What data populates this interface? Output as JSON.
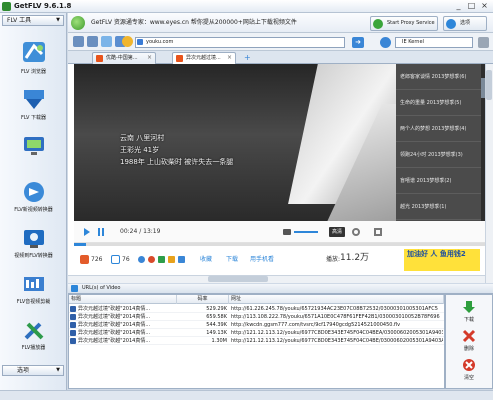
{
  "window": {
    "title": "GetFLV 9.6.1.8",
    "minimize": "_",
    "maximize": "□",
    "close": "×"
  },
  "sidebar": {
    "header": "FLV 工具",
    "items": [
      {
        "label": "FLV 浏览器"
      },
      {
        "label": "FLV 下载器"
      },
      {
        "label": ""
      },
      {
        "label": "FLV新视频转换器"
      },
      {
        "label": "视频到FLV转换器"
      },
      {
        "label": "FLV音视频剪裁"
      },
      {
        "label": "FLV播放器"
      }
    ],
    "footer": "选项"
  },
  "topbar": {
    "banner": "GetFLV 资源通专家：www.eyes.cn 帮你提从200000+网站上下载视频文件",
    "proxy_button": "Start Proxy Service",
    "options_button": "选项"
  },
  "navbar": {
    "url": "youku.com",
    "engine": "IE Kernel",
    "go": "➜"
  },
  "tabs": [
    {
      "label": "优酷-中国第...",
      "close": "×"
    },
    {
      "label": "异次元越过境...",
      "close": "×"
    },
    {
      "label": "+"
    }
  ],
  "video": {
    "subtitle_lines": [
      "云南  八里河村",
      "王彩光  41岁",
      "1988年 上山砍柴时 被许失去一条腿"
    ],
    "time": "00:24 / 13:19",
    "quality": "高清",
    "progress": 0.03
  },
  "recommendations": [
    "老郎客家谈情 2013梦想季(6)",
    "生命的重量 2013梦想季(5)",
    "两个人的梦想 2013梦想季(4)",
    "领跑24小时 2013梦想季(3)",
    "盲嘻谱 2013梦想季(2)",
    "越光 2013梦想季(1)"
  ],
  "infobar": {
    "likes": "726",
    "comments": "76",
    "collect": "收藏",
    "download": "下载",
    "share": "用手机看",
    "playcount_label": "播放:",
    "playcount": "11.2万",
    "ad": "加油好 人 鱼用钱2"
  },
  "urls_panel": {
    "title": "URL(s) of Video",
    "columns": [
      "标题",
      "码率",
      "网址"
    ],
    "rows": [
      {
        "title": "异次元越过境\"砍越\"2014真情...",
        "size": "529.29K",
        "url": "http://61.226.245.78/youku/65721934AC23E07C08B72532/03000301005301AFC5"
      },
      {
        "title": "异次元越过境\"砍越\"2014真情...",
        "size": "659.58K",
        "url": "http://113.108.222.78/youku/6571A10E0C478F61FEF42B1/030003010052B78F696"
      },
      {
        "title": "异次元越过境\"砍越\"2014真情...",
        "size": "544.39K",
        "url": "http://kwcdn.ggsm777.com/tvsrc/9cf17940gcdg5214521000450.flv"
      },
      {
        "title": "异次元越过境\"砍越\"2014真情...",
        "size": "149.13K",
        "url": "http://121.12.113.12/youku/6977C8D0E343E745F04C04BEA/03000602005301A9403A0"
      },
      {
        "title": "异次元越过境\"砍越\"2014真情...",
        "size": "1.30M",
        "url": "http://121.12.113.12/youku/6977C8D0E343E745F04C04BE/03000602005301A9403A0"
      }
    ],
    "actions": [
      "下载",
      "删除",
      "清空"
    ]
  },
  "colors": {
    "accent": "#2d86d9",
    "brand_green": "#2f8a2f",
    "video_bg": "#2a2a2a"
  }
}
